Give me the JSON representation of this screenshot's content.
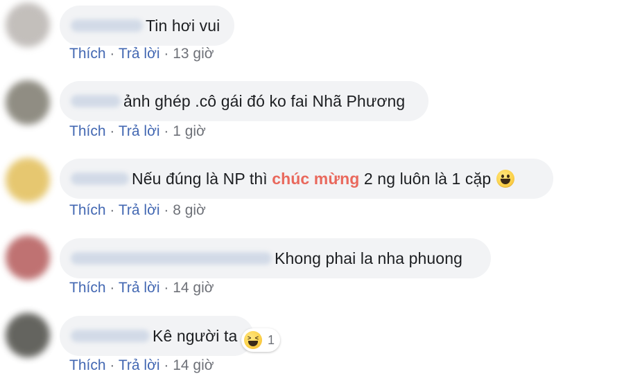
{
  "actions": {
    "like_label": "Thích",
    "reply_label": "Trả lời",
    "separator": "·"
  },
  "comments": [
    {
      "text": "Tin hơi vui",
      "time": "13 giờ",
      "avatar_color": "#b9b4b0"
    },
    {
      "text": "ảnh ghép .cô gái đó ko fai Nhã Phương",
      "time": "1 giờ",
      "avatar_color": "#7d7a6e"
    },
    {
      "text_before": "Nếu đúng là NP thì",
      "highlight": "chúc mừng",
      "text_after": "2 ng luôn là 1 cặp",
      "emoji": "grinning-face-emoji",
      "highlight_color": "#e9685c",
      "time": "8 giờ",
      "avatar_color": "#e2be58"
    },
    {
      "text": "Khong phai la nha phuong",
      "time": "14 giờ",
      "avatar_color": "#b45a5a"
    },
    {
      "text": "Kê người ta",
      "time": "14 giờ",
      "avatar_color": "#4a4a44",
      "reaction": {
        "icon": "laughing-face-icon",
        "count": "1"
      }
    }
  ]
}
